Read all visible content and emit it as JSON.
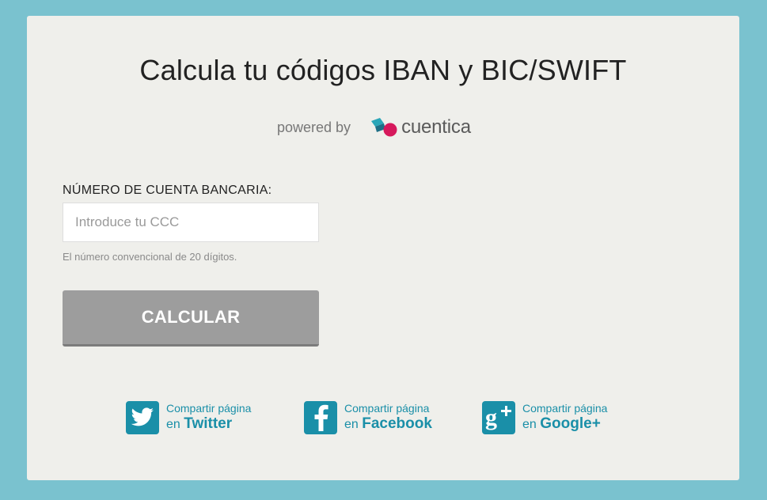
{
  "page": {
    "title": "Calcula tu códigos IBAN y BIC/SWIFT",
    "powered_by": "powered by",
    "logo_text": "cuentica"
  },
  "form": {
    "label": "NÚMERO DE CUENTA BANCARIA:",
    "input_placeholder": "Introduce tu CCC",
    "input_value": "",
    "help": "El número convencional de 20 dígitos.",
    "submit_label": "CALCULAR"
  },
  "share": [
    {
      "line1": "Compartir página",
      "prefix": "en",
      "network": "Twitter",
      "icon": "twitter-icon"
    },
    {
      "line1": "Compartir página",
      "prefix": "en",
      "network": "Facebook",
      "icon": "facebook-icon"
    },
    {
      "line1": "Compartir página",
      "prefix": "en",
      "network": "Google+",
      "icon": "google-plus-icon"
    }
  ],
  "colors": {
    "background": "#7ac2cf",
    "card": "#efefeb",
    "button": "#9d9d9d",
    "share_accent": "#1a8fa8",
    "logo_teal": "#2aa6b8",
    "logo_pink": "#d6195c"
  }
}
